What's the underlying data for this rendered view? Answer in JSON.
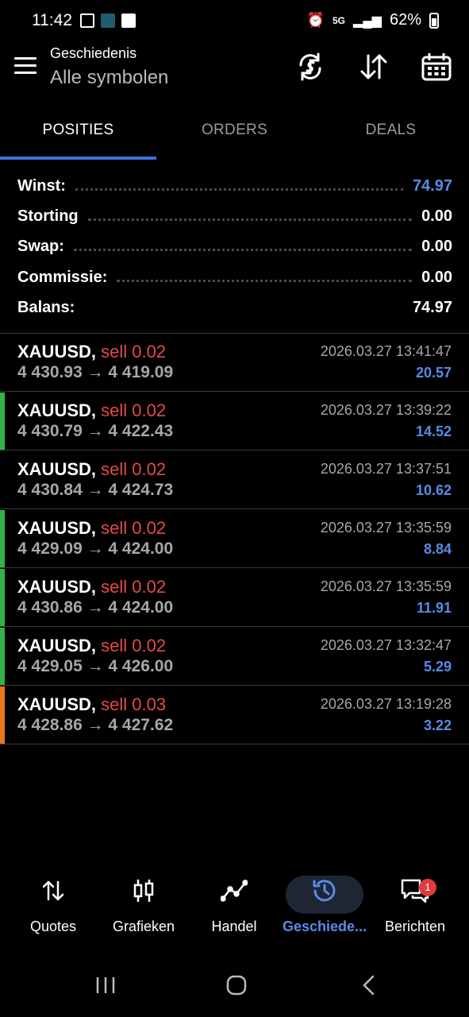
{
  "status_bar": {
    "time": "11:42",
    "network": "5G",
    "battery": "62%"
  },
  "header": {
    "title": "Geschiedenis",
    "subtitle": "Alle symbolen"
  },
  "tabs": [
    {
      "label": "POSITIES",
      "active": true
    },
    {
      "label": "ORDERS",
      "active": false
    },
    {
      "label": "DEALS",
      "active": false
    }
  ],
  "summary": [
    {
      "label": "Winst:",
      "value": "74.97"
    },
    {
      "label": "Storting",
      "value": "0.00"
    },
    {
      "label": "Swap:",
      "value": "0.00"
    },
    {
      "label": "Commissie:",
      "value": "0.00"
    },
    {
      "label": "Balans:",
      "value": "74.97"
    }
  ],
  "deals": [
    {
      "symbol": "XAUUSD,",
      "side": "sell 0.02",
      "prices": "4 430.93 → 4 419.09",
      "datetime": "2026.03.27 13:41:47",
      "profit": "20.57",
      "marker": ""
    },
    {
      "symbol": "XAUUSD,",
      "side": "sell 0.02",
      "prices": "4 430.79 → 4 422.43",
      "datetime": "2026.03.27 13:39:22",
      "profit": "14.52",
      "marker": "#34b24a"
    },
    {
      "symbol": "XAUUSD,",
      "side": "sell 0.02",
      "prices": "4 430.84 → 4 424.73",
      "datetime": "2026.03.27 13:37:51",
      "profit": "10.62",
      "marker": ""
    },
    {
      "symbol": "XAUUSD,",
      "side": "sell 0.02",
      "prices": "4 429.09 → 4 424.00",
      "datetime": "2026.03.27 13:35:59",
      "profit": "8.84",
      "marker": "#34b24a"
    },
    {
      "symbol": "XAUUSD,",
      "side": "sell 0.02",
      "prices": "4 430.86 → 4 424.00",
      "datetime": "2026.03.27 13:35:59",
      "profit": "11.91",
      "marker": "#34b24a"
    },
    {
      "symbol": "XAUUSD,",
      "side": "sell 0.02",
      "prices": "4 429.05 → 4 426.00",
      "datetime": "2026.03.27 13:32:47",
      "profit": "5.29",
      "marker": "#34b24a"
    },
    {
      "symbol": "XAUUSD,",
      "side": "sell 0.03",
      "prices": "4 428.86 → 4 427.62",
      "datetime": "2026.03.27 13:19:28",
      "profit": "3.22",
      "marker": "#e8781e"
    }
  ],
  "bottom_nav": [
    {
      "label": "Quotes",
      "icon": "quotes-arrows-icon",
      "active": false
    },
    {
      "label": "Grafieken",
      "icon": "candlestick-icon",
      "active": false
    },
    {
      "label": "Handel",
      "icon": "trade-line-icon",
      "active": false
    },
    {
      "label": "Geschiede...",
      "icon": "history-icon",
      "active": true
    },
    {
      "label": "Berichten",
      "icon": "messages-icon",
      "active": false,
      "badge": "1"
    }
  ],
  "colors": {
    "accent": "#3d6fd8",
    "profit": "#5a8ae6",
    "sell": "#e24a4a",
    "green_marker": "#34b24a",
    "orange_marker": "#e8781e"
  }
}
